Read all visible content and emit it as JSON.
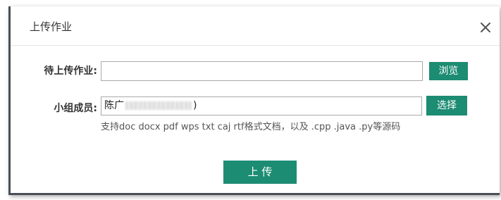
{
  "dialog": {
    "title": "上传作业",
    "close_label": "×"
  },
  "form": {
    "work_label": "待上传作业:",
    "work_value": "",
    "browse_label": "浏览",
    "members_label": "小组成员:",
    "members_prefix": "陈广",
    "members_suffix": ")",
    "select_label": "选择",
    "hint": "支持doc  docx  pdf  wps  txt  caj  rtf格式文档，以及 .cpp  .java  .py等源码"
  },
  "actions": {
    "upload_label": "上 传"
  },
  "colors": {
    "primary": "#1c8c73",
    "border": "#a9a9a9"
  },
  "icons": {
    "close": "close-icon"
  }
}
